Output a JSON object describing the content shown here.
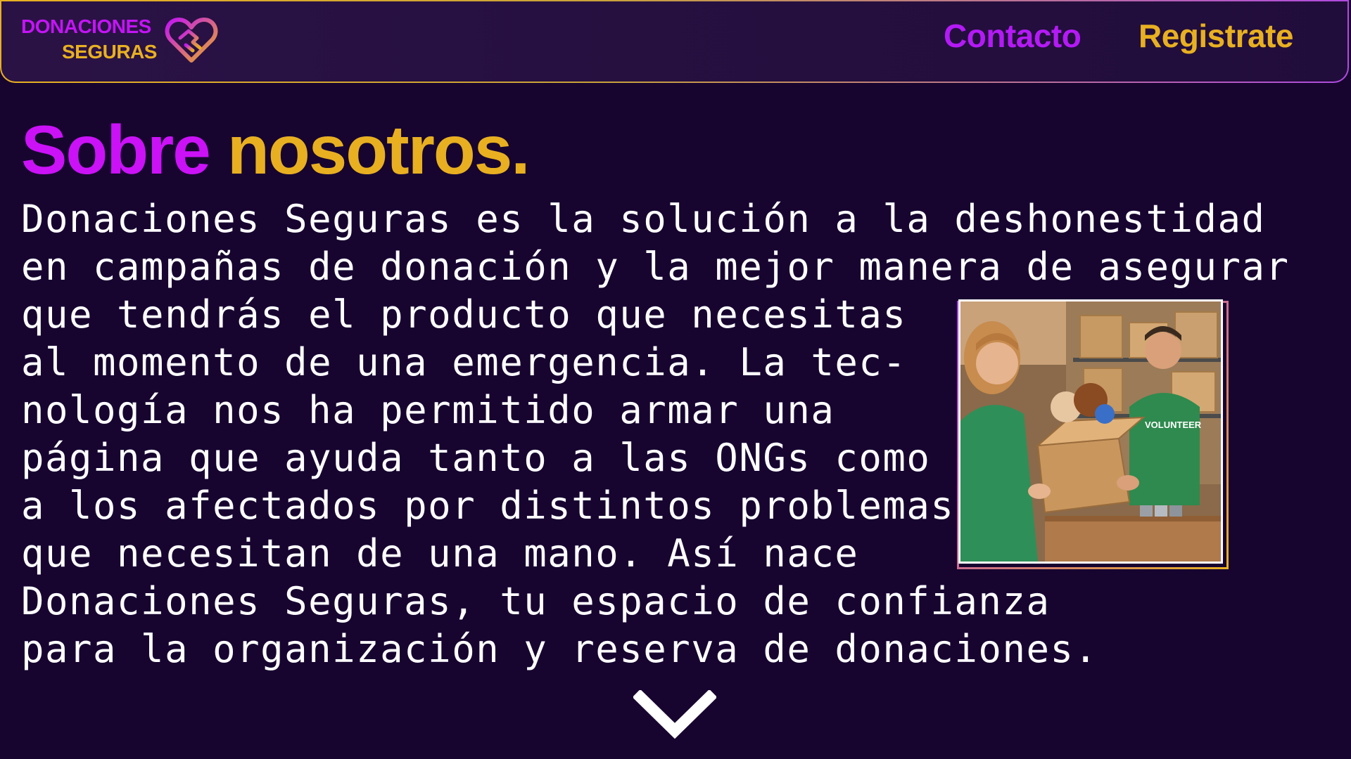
{
  "brand": {
    "line1": "DONACIONES",
    "line2": "SEGURAS",
    "icon": "heart-handshake-icon",
    "colors": {
      "purple": "#cb12f7",
      "gold": "#e8b021",
      "background": "#170530"
    }
  },
  "nav": {
    "contacto": "Contacto",
    "registrate": "Registrate"
  },
  "main": {
    "title_part1": "Sobre",
    "title_part2": "nosotros.",
    "paragraph_lines": [
      "Donaciones Seguras es la solución a la deshonestidad",
      "en campañas de donación y la mejor manera de asegurar",
      "que tendrás el producto que necesitas",
      "al momento de una emergencia. La tec-",
      "nología nos ha permitido armar una",
      "página que ayuda tanto a las ONGs como",
      "a los afectados por distintos problemas",
      "que necesitan de una mano. Así nace",
      "Donaciones Seguras, tu espacio de confianza",
      "para la organización y reserva de donaciones."
    ],
    "photo_volunteer_label": "VOLUNTEER",
    "scroll_icon": "chevron-down-icon"
  }
}
